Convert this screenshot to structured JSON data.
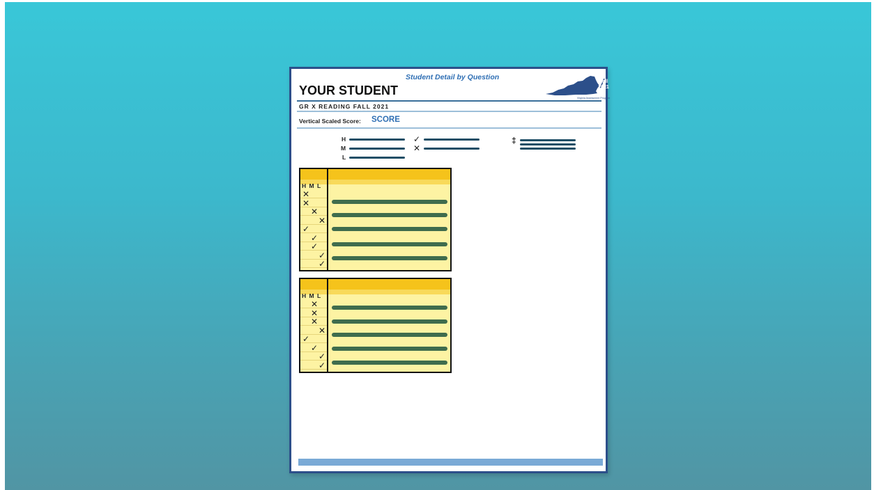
{
  "report": {
    "subtitle": "Student Detail by Question",
    "title": "YOUR STUDENT",
    "badge": {
      "season": "Fall",
      "year": "2021",
      "caption": "Virginia Assessment Program"
    },
    "grade_line": "GR X  READING  FALL 2021",
    "score_label": "Vertical Scaled Score:",
    "score_value": "SCORE"
  },
  "legend": {
    "levels": [
      "H",
      "M",
      "L"
    ],
    "check_symbol": "✓",
    "cross_symbol": "✕",
    "dagger_symbol": "‡"
  },
  "blocks": [
    {
      "header": "H M L",
      "marks": [
        {
          "symbol": "✕",
          "level": "H"
        },
        {
          "symbol": "✕",
          "level": "H"
        },
        {
          "symbol": "✕",
          "level": "M"
        },
        {
          "symbol": "✕",
          "level": "L"
        },
        {
          "symbol": "✓",
          "level": "H"
        },
        {
          "symbol": "✓",
          "level": "M"
        },
        {
          "symbol": "✓",
          "level": "M"
        },
        {
          "symbol": "✓",
          "level": "L"
        },
        {
          "symbol": "✓",
          "level": "L"
        }
      ]
    },
    {
      "header": "H M L",
      "marks": [
        {
          "symbol": "✕",
          "level": "M"
        },
        {
          "symbol": "✕",
          "level": "M"
        },
        {
          "symbol": "✕",
          "level": "M"
        },
        {
          "symbol": "✕",
          "level": "L"
        },
        {
          "symbol": "✓",
          "level": "H"
        },
        {
          "symbol": "✓",
          "level": "M"
        },
        {
          "symbol": "✓",
          "level": "L"
        },
        {
          "symbol": "✓",
          "level": "L"
        }
      ]
    }
  ],
  "colors": {
    "background": "#3cb8cc",
    "accent_blue": "#2f6fb4",
    "header_gold": "#f5c31b",
    "row_yellow": "#fdf3a3",
    "bar_green": "#3f6c4d",
    "footer_blue": "#7aaad6"
  }
}
